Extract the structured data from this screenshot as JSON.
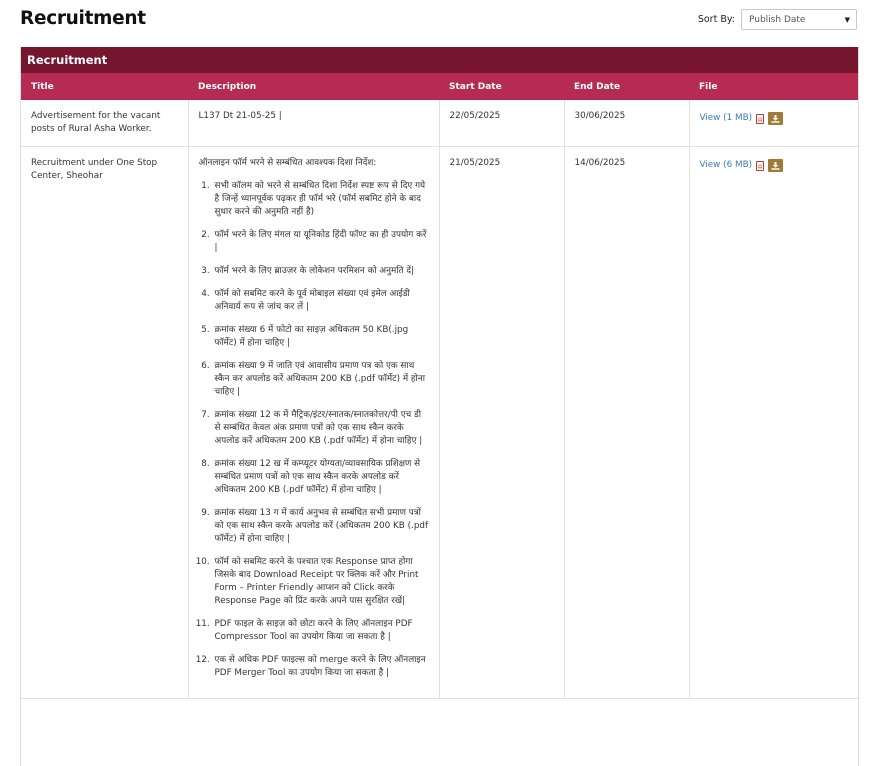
{
  "page": {
    "title": "Recruitment"
  },
  "sort": {
    "label": "Sort By:",
    "selected": "Publish Date"
  },
  "panel": {
    "title": "Recruitment"
  },
  "table": {
    "headers": [
      "Title",
      "Description",
      "Start Date",
      "End Date",
      "File"
    ],
    "rows": [
      {
        "title": "Advertisement for the vacant posts of Rural Asha Worker.",
        "description": "L137 Dt 21-05-25 |",
        "start": "22/05/2025",
        "end": "30/06/2025",
        "file": "View (1 MB)"
      },
      {
        "title": "Recruitment under One Stop Center, Sheohar",
        "description_intro": "ऑनलाइन फॉर्म भरने से सम्बंधित आवश्यक दिशा निर्देश:",
        "description_items": [
          "सभी कॉलम को भरने से सम्बंधित दिशा निर्देश स्पष्ट रूप से दिए गये है जिन्हें ध्यानपूर्वक पढ़कर ही फॉर्म भरे (फॉर्म सबमिट होने के बाद सुधार करने की अनुमति नहीं है)",
          "फॉर्म भरने के लिए मंगल या यूनिकोड हिंदी फॉण्ट का ही उपयोग करें |",
          "फॉर्म भरने के लिए ब्राउज़र के लोकेशन परमिशन को अनुमति दें|",
          "फॉर्म को सबमिट करने के पूर्व मोबाइल संख्या एवं इमेल आईडी अनिवार्य रूप से जांच कर लें |",
          "क्रमांक संख्या 6 में फोटो का साइज़ अधिकतम 50 KB(.jpg फॉर्मेट) में होना चाहिए |",
          "क्रमांक संख्या 9 में जाति एवं आवासीय प्रमाण पत्र को एक साथ स्कैन कर अपलोड करें अधिकतम 200 KB (.pdf फॉर्मेट) में होना चाहिए |",
          "क्रमांक संख्या 12 क में मैट्रिक/इंटर/स्नातक/स्नातकोत्तर/पी एच डी से सम्बंधित केवल अंक प्रमाण पत्रों को एक साथ स्कैन करके अपलोड करें अधिकतम 200 KB (.pdf फॉर्मेट) में होना चाहिए |",
          "क्रमांक संख्या 12 ख में कम्प्यूटर योग्यता/व्यावसायिक प्रशिक्षण से सम्बंधित प्रमाण पत्रों को एक साथ स्कैन करके अपलोड करें अधिकतम 200 KB (.pdf फॉर्मेट) में होना चाहिए |",
          "क्रमांक संख्या 13 ग में कार्य अनुभव से सम्बंधित सभी प्रमाण पत्रों को एक साथ स्कैन करके अपलोड करें (अधिकतम 200 KB (.pdf फॉर्मेट) में होना चाहिए |",
          "फॉर्म को सबमिट करने के पश्चात एक Response प्राप्त होगा जिसके बाद Download Receipt पर क्लिक करें और Print Form – Printer Friendly आप्शन को Click करके Response Page को प्रिंट करके अपने पास सुरक्षित रखें|",
          "PDF फाइल के साइज़ को छोटा करने के लिए ऑनलाइन PDF Compressor Tool का उपयोग किया जा सकता है |",
          "एक से अधिक PDF फाइल्स को merge करने के लिए ऑनलाइन PDF Merger Tool का उपयोग किया जा सकता है |"
        ],
        "start": "21/05/2025",
        "end": "14/06/2025",
        "file": "View (6 MB)"
      }
    ]
  },
  "icons": {
    "pdf": "pdf-icon",
    "download": "download-icon",
    "dropdown": "chevron-down-icon"
  },
  "colors": {
    "panel_header": "#76162e",
    "table_header": "#b52b52",
    "link": "#3a79b8",
    "download_button": "#a07a38"
  }
}
